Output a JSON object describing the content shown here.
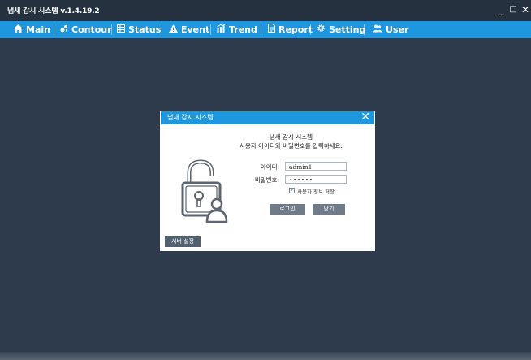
{
  "window": {
    "title": "냄새 감시 시스템 v.1.4.19.2",
    "minimize_glyph": "_",
    "maximize_glyph": "□",
    "close_glyph": "✕"
  },
  "menu": [
    {
      "label": "Main",
      "icon": "home-icon"
    },
    {
      "label": "Contour",
      "icon": "contour-icon"
    },
    {
      "label": "Status",
      "icon": "status-grid-icon"
    },
    {
      "label": "Event",
      "icon": "warning-icon"
    },
    {
      "label": "Trend",
      "icon": "trend-chart-icon"
    },
    {
      "label": "Report",
      "icon": "report-document-icon"
    },
    {
      "label": "Setting",
      "icon": "gear-icon"
    },
    {
      "label": "User",
      "icon": "users-icon"
    }
  ],
  "dialog": {
    "title": "냄새 감시 시스템",
    "heading": "냄새 감시 시스템",
    "message": "사용자 아이디와 비밀번호를 입력하세요.",
    "id_label": "아이디:",
    "id_value": "admin1",
    "password_label": "비밀번호:",
    "password_value": "••••••",
    "remember_label": "사용자 정보 저장",
    "remember_checked": true,
    "login_button": "로그인",
    "close_button": "닫기",
    "server_button": "서버 설정"
  },
  "colors": {
    "accent": "#1f97df",
    "background": "#2d3b4d",
    "titlebar": "#25313f",
    "button": "#6f7b88"
  }
}
